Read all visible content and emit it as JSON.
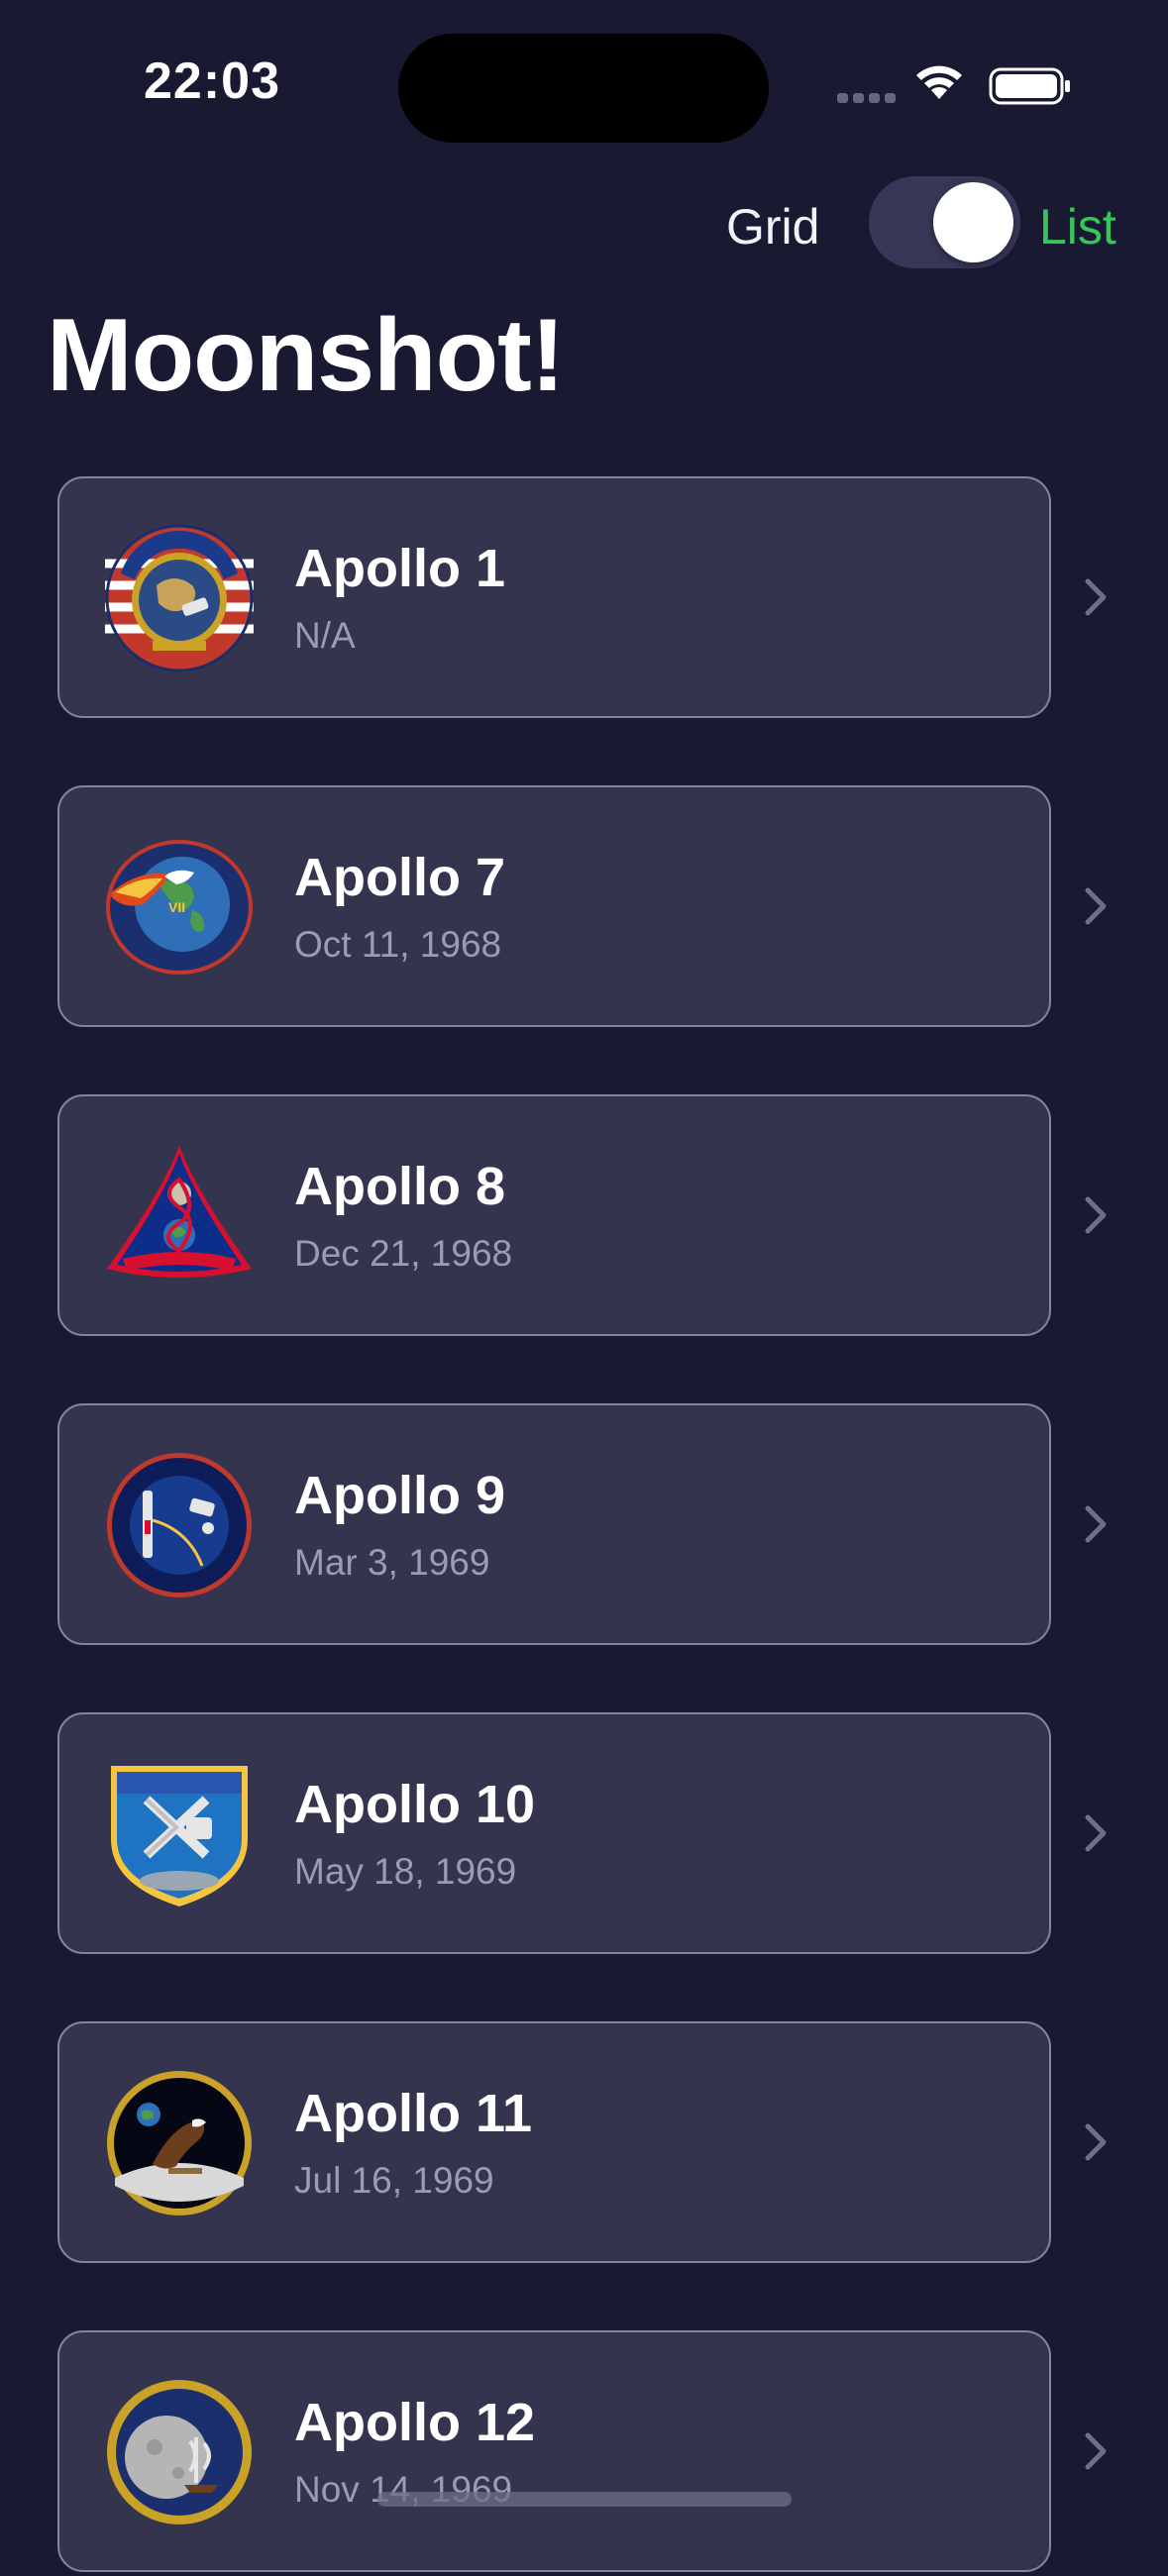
{
  "status_bar": {
    "time": "22:03"
  },
  "view_toggle": {
    "left_label": "Grid",
    "right_label": "List",
    "is_on": true,
    "on_color": "#34c759"
  },
  "page": {
    "title": "Moonshot!"
  },
  "colors": {
    "background": "#191a32",
    "card": "#35344f",
    "card_border": "#86869a",
    "accent": "#34c759"
  },
  "missions": [
    {
      "name": "Apollo 1",
      "date": "N/A",
      "badge": "apollo-1-patch-icon"
    },
    {
      "name": "Apollo 7",
      "date": "Oct 11, 1968",
      "badge": "apollo-7-patch-icon"
    },
    {
      "name": "Apollo 8",
      "date": "Dec 21, 1968",
      "badge": "apollo-8-patch-icon"
    },
    {
      "name": "Apollo 9",
      "date": "Mar 3, 1969",
      "badge": "apollo-9-patch-icon"
    },
    {
      "name": "Apollo 10",
      "date": "May 18, 1969",
      "badge": "apollo-10-patch-icon"
    },
    {
      "name": "Apollo 11",
      "date": "Jul 16, 1969",
      "badge": "apollo-11-patch-icon"
    },
    {
      "name": "Apollo 12",
      "date": "Nov 14, 1969",
      "badge": "apollo-12-patch-icon"
    }
  ]
}
